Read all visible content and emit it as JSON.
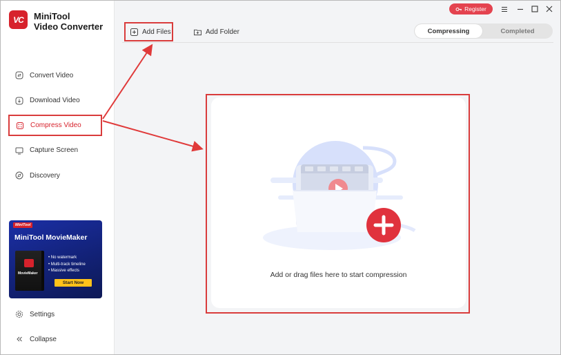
{
  "app": {
    "name_line1": "MiniTool",
    "name_line2": "Video Converter",
    "logo_text": "VC"
  },
  "nav": [
    {
      "id": "convert",
      "label": "Convert Video",
      "icon": "convert-icon",
      "active": false
    },
    {
      "id": "download",
      "label": "Download Video",
      "icon": "download-icon",
      "active": false
    },
    {
      "id": "compress",
      "label": "Compress Video",
      "icon": "compress-icon",
      "active": true
    },
    {
      "id": "capture",
      "label": "Capture Screen",
      "icon": "capture-icon",
      "active": false
    },
    {
      "id": "discovery",
      "label": "Discovery",
      "icon": "compass-icon",
      "active": false
    }
  ],
  "promo": {
    "badge": "MiniTool",
    "title": "MiniTool MovieMaker",
    "box_name": "MovieMaker",
    "features": [
      "• No watermark",
      "• Multi-track timeline",
      "• Massive effects"
    ],
    "button": "Start Now"
  },
  "bottom": {
    "settings": "Settings",
    "collapse": "Collapse"
  },
  "topbar": {
    "register": "Register"
  },
  "toolbar": {
    "add_files": "Add Files",
    "add_folder": "Add Folder"
  },
  "tabs": {
    "compressing": "Compressing",
    "completed": "Completed"
  },
  "dropzone": {
    "text": "Add or drag files here to start compression"
  },
  "colors": {
    "accent": "#d7222c",
    "highlight": "#d93b3b"
  }
}
